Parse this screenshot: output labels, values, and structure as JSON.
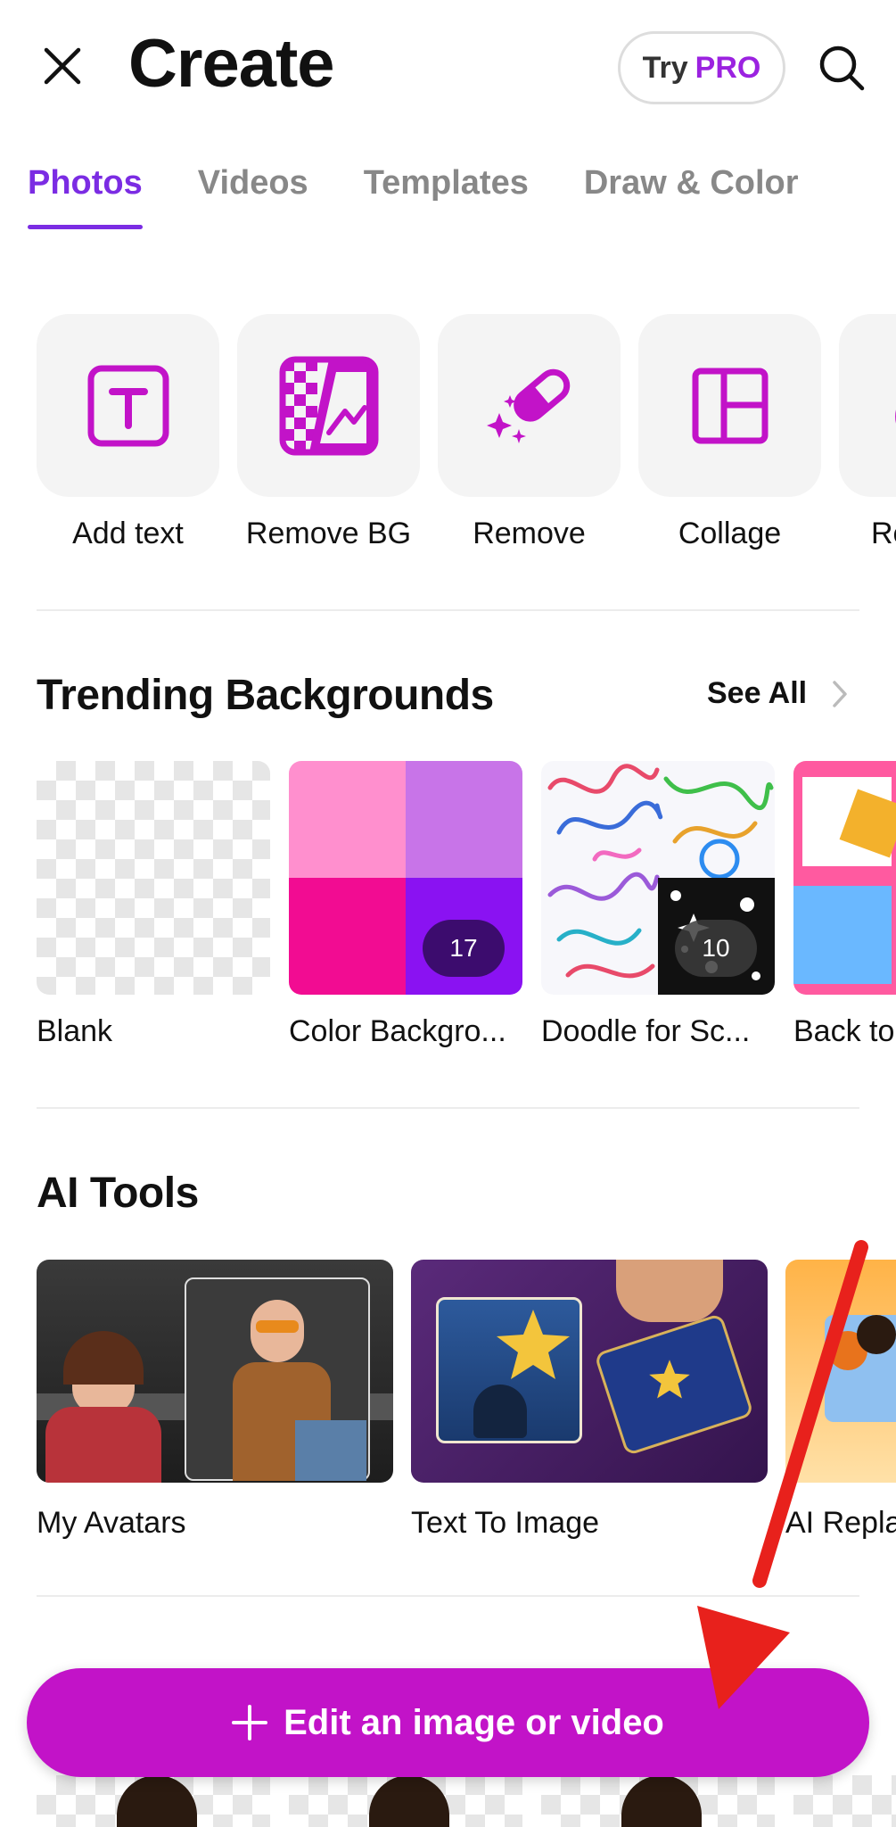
{
  "header": {
    "title": "Create",
    "try_label": "Try",
    "pro_label": "PRO"
  },
  "tabs": [
    {
      "label": "Photos",
      "active": true
    },
    {
      "label": "Videos",
      "active": false
    },
    {
      "label": "Templates",
      "active": false
    },
    {
      "label": "Draw & Color",
      "active": false
    }
  ],
  "tools": [
    {
      "label": "Add text",
      "icon": "text-box-icon"
    },
    {
      "label": "Remove BG",
      "icon": "remove-bg-icon"
    },
    {
      "label": "Remove",
      "icon": "eraser-sparkle-icon"
    },
    {
      "label": "Collage",
      "icon": "collage-grid-icon"
    },
    {
      "label": "Re",
      "icon": "partial-tool-icon"
    }
  ],
  "backgrounds": {
    "title": "Trending Backgrounds",
    "see_all": "See All",
    "items": [
      {
        "label": "Blank"
      },
      {
        "label": "Color Backgro...",
        "count": "17"
      },
      {
        "label": "Doodle for Sc...",
        "count": "10"
      },
      {
        "label": "Back to"
      }
    ]
  },
  "ai_tools": {
    "title": "AI Tools",
    "items": [
      {
        "label": "My Avatars"
      },
      {
        "label": "Text To Image"
      },
      {
        "label": "AI Repla"
      }
    ]
  },
  "cta": {
    "label": "Edit an image or video"
  },
  "colors": {
    "accent": "#7b2ce3",
    "icon": "#c213c8",
    "cta": "#c213c8",
    "annotation_arrow": "#e8211c"
  }
}
